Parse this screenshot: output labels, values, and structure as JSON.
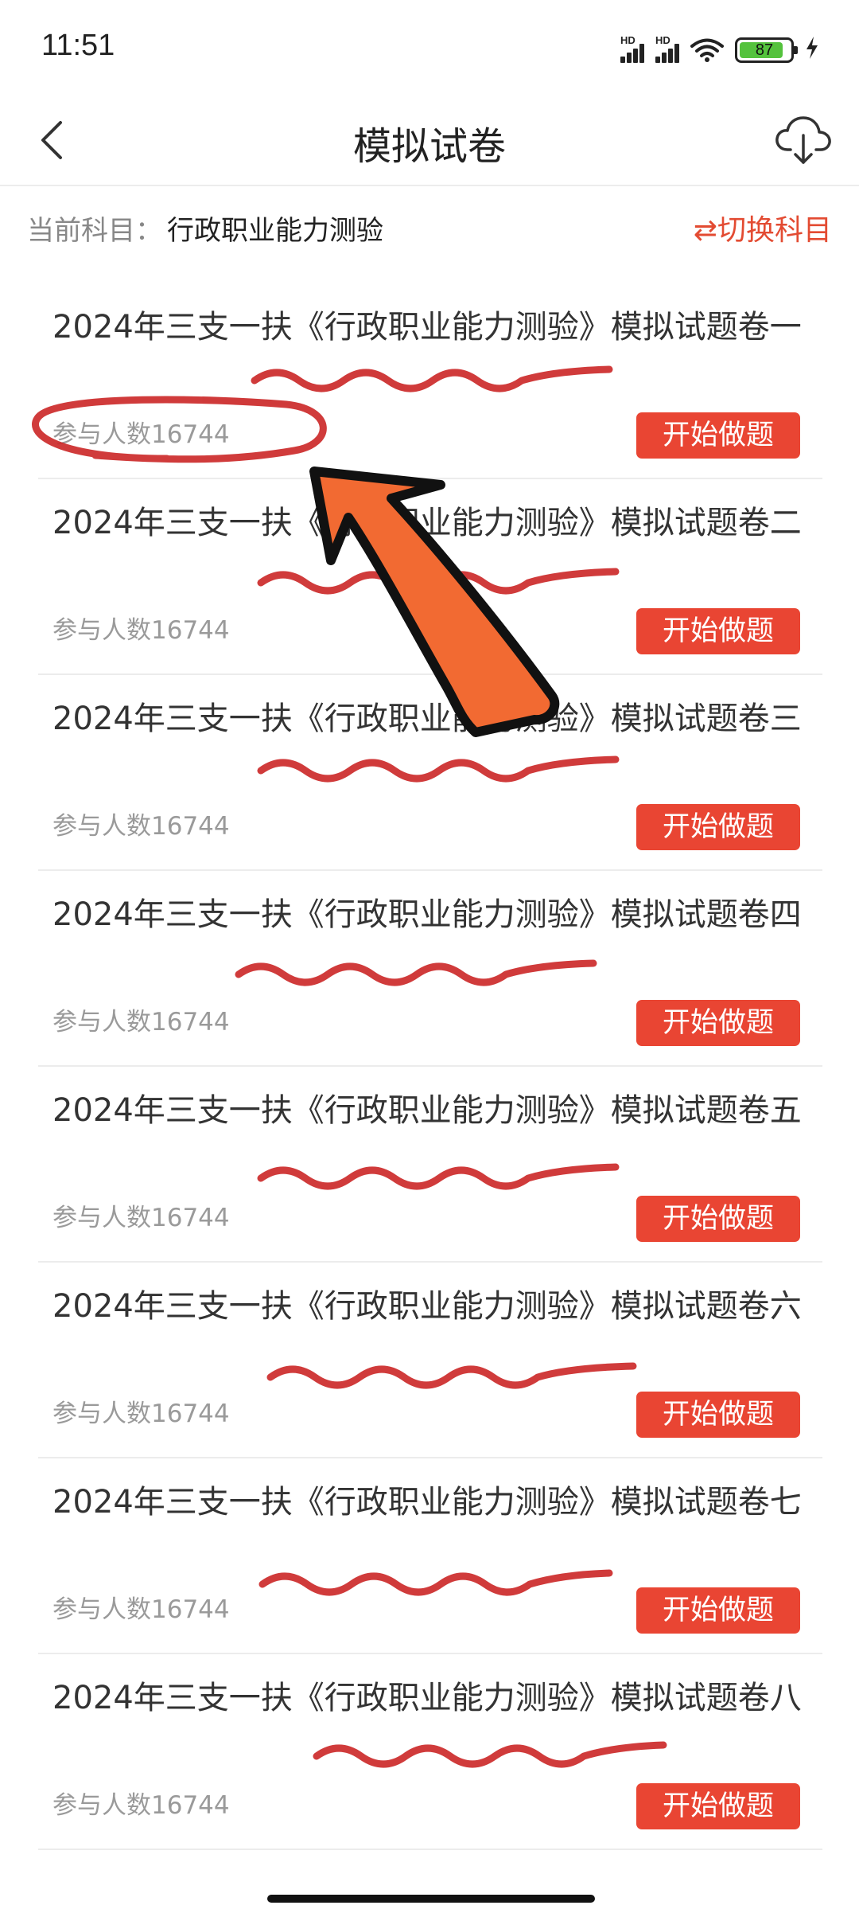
{
  "status_bar": {
    "time": "11:51",
    "signal1_label": "HD",
    "signal2_label": "HD",
    "battery": "87",
    "battery_level": 0.87,
    "battery_color": "#54c23d"
  },
  "nav": {
    "title": "模拟试卷",
    "back_icon": "chevron-left-icon",
    "download_icon": "cloud-download-icon"
  },
  "subject": {
    "label": "当前科目：",
    "value": "行政职业能力测验",
    "switch_icon": "swap-arrows-icon",
    "switch_label": "⇄切换科目"
  },
  "colors": {
    "accent": "#e94533",
    "annotation_red": "#cc2a2a",
    "arrow_orange": "#f26a32"
  },
  "papers": [
    {
      "title": "2024年三支一扶《行政职业能力测验》模拟试题卷一",
      "participants": "参与人数16744",
      "button": "开始做题"
    },
    {
      "title": "2024年三支一扶《行政职业能力测验》模拟试题卷二",
      "participants": "参与人数16744",
      "button": "开始做题"
    },
    {
      "title": "2024年三支一扶《行政职业能力测验》模拟试题卷三",
      "participants": "参与人数16744",
      "button": "开始做题"
    },
    {
      "title": "2024年三支一扶《行政职业能力测验》模拟试题卷四",
      "participants": "参与人数16744",
      "button": "开始做题"
    },
    {
      "title": "2024年三支一扶《行政职业能力测验》模拟试题卷五",
      "participants": "参与人数16744",
      "button": "开始做题"
    },
    {
      "title": "2024年三支一扶《行政职业能力测验》模拟试题卷六",
      "participants": "参与人数16744",
      "button": "开始做题"
    },
    {
      "title": "2024年三支一扶《行政职业能力测验》模拟试题卷七",
      "participants": "参与人数16744",
      "button": "开始做题"
    },
    {
      "title": "2024年三支一扶《行政职业能力测验》模拟试题卷八",
      "participants": "参与人数16744",
      "button": "开始做题"
    }
  ]
}
